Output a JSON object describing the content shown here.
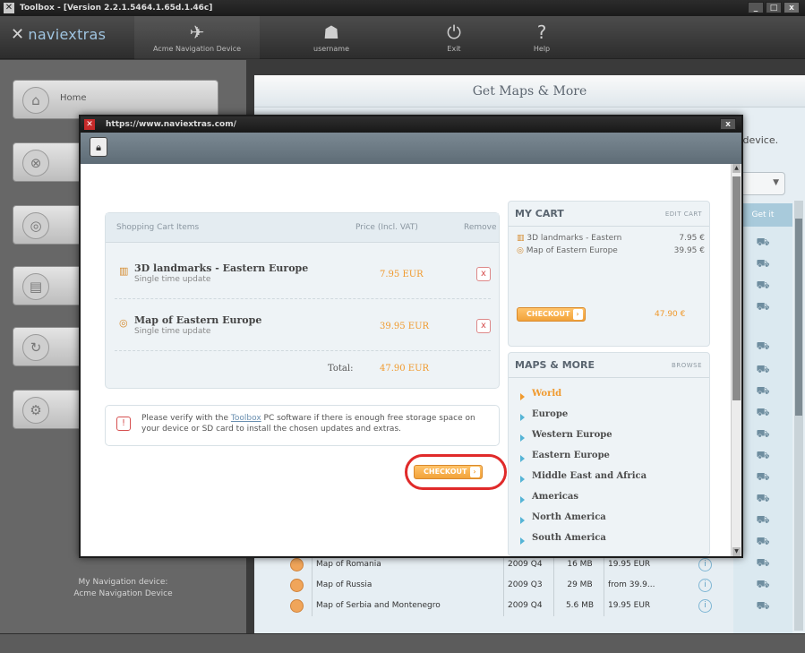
{
  "window": {
    "title": "Toolbox - [Version 2.2.1.5464.1.65d.1.46c]",
    "controls": [
      "_",
      "□",
      "x"
    ]
  },
  "toolbar": {
    "brand": "naviextras",
    "device": "Acme Navigation Device",
    "user": "username",
    "exit": "Exit",
    "help": "Help"
  },
  "sidebar": {
    "items": [
      {
        "label": "Home",
        "icon": "house-icon"
      },
      {
        "label": "",
        "icon": "disc-icon"
      },
      {
        "label": "",
        "icon": "globe-icon"
      },
      {
        "label": "",
        "icon": "device-icon"
      },
      {
        "label": "",
        "icon": "refresh-icon"
      },
      {
        "label": "",
        "icon": "settings-icon"
      }
    ],
    "device_info": {
      "label": "My Navigation device:",
      "name": "Acme Navigation Device"
    }
  },
  "main": {
    "title": "Get Maps & More",
    "partial_text": "n device.",
    "col_header": "Get it",
    "rows": [
      {
        "name": "Map of Romania",
        "date": "2009 Q4",
        "size": "16 MB",
        "price": "19.95 EUR"
      },
      {
        "name": "Map of Russia",
        "date": "2009 Q3",
        "size": "29 MB",
        "price": "from 39.9..."
      },
      {
        "name": "Map of Serbia and Montenegro",
        "date": "2009 Q4",
        "size": "5.6 MB",
        "price": "19.95 EUR"
      }
    ]
  },
  "popup": {
    "url": "https://www.naviextras.com/",
    "close": "x",
    "cart": {
      "headers": {
        "items": "Shopping Cart Items",
        "price": "Price (Incl. VAT)",
        "remove": "Remove"
      },
      "items": [
        {
          "name": "3D landmarks - Eastern Europe",
          "sub": "Single time update",
          "price": "7.95 EUR",
          "remove": "x"
        },
        {
          "name": "Map of Eastern Europe",
          "sub": "Single time update",
          "price": "39.95 EUR",
          "remove": "x"
        }
      ],
      "total_label": "Total:",
      "total_value": "47.90 EUR"
    },
    "notice": {
      "before": "Please verify with the ",
      "link": "Toolbox",
      "after": " PC software if there is enough free storage space on your device or SD card to install the chosen updates and extras."
    },
    "checkout": "CHECKOUT",
    "my_cart": {
      "title": "MY CART",
      "action": "EDIT CART",
      "items": [
        {
          "name": "3D landmarks - Eastern",
          "price": "7.95 €"
        },
        {
          "name": "Map of Eastern Europe",
          "price": "39.95 €"
        }
      ],
      "checkout": "CHECKOUT",
      "total": "47.90 €"
    },
    "maps_more": {
      "title": "MAPS & MORE",
      "action": "BROWSE",
      "items": [
        "World",
        "Europe",
        "Western Europe",
        "Eastern Europe",
        "Middle East and Africa",
        "Americas",
        "North America",
        "South America"
      ],
      "active": "World"
    }
  },
  "colors": {
    "accent_orange": "#f09a2e",
    "highlight_red": "#e02a2a",
    "link_blue": "#55b4d6"
  }
}
